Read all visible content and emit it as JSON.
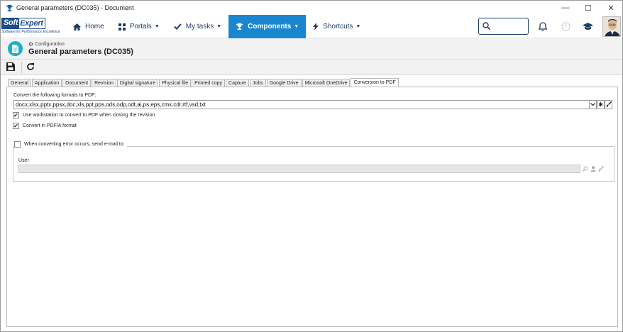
{
  "window": {
    "title": "General parameters (DC035) - Document",
    "controls": {
      "minimize": "—",
      "maximize": "☐",
      "close": "✕"
    }
  },
  "brand": {
    "soft": "Soft",
    "expert": "Expert",
    "tagline": "Software for Performance Excellence"
  },
  "nav": {
    "items": [
      {
        "label": "Home",
        "icon": "home-icon"
      },
      {
        "label": "Portals",
        "icon": "portals-icon"
      },
      {
        "label": "My tasks",
        "icon": "check-icon"
      },
      {
        "label": "Components",
        "icon": "trophy-icon"
      },
      {
        "label": "Shortcuts",
        "icon": "bolt-icon"
      }
    ],
    "active_color": "#1a86d0"
  },
  "header": {
    "breadcrumb": "Configuration",
    "title": "General parameters (DC035)"
  },
  "tabs": [
    "General",
    "Application",
    "Document",
    "Revision",
    "Digital signature",
    "Physical file",
    "Printed copy",
    "Capture",
    "Jobs",
    "Google Drive",
    "Microsoft OneDrive",
    "Conversion to PDF"
  ],
  "form": {
    "formats_label": "Convert the following formats to PDF:",
    "formats_value": "docx,xlsx,pptx,ppsx,doc,xls,ppt,pps,ods,odp,odt,ai,ps,eps,cmx,cdr,rtf,vsd,txt",
    "workstation_label": "Use workstation to convert to PDF when closing the revision",
    "workstation_checked": true,
    "pdfa_label": "Convert in PDF/A format",
    "pdfa_checked": true,
    "email_label": "When converting error occurs, send e-mail to:",
    "email_checked": false,
    "user_label": "User"
  }
}
